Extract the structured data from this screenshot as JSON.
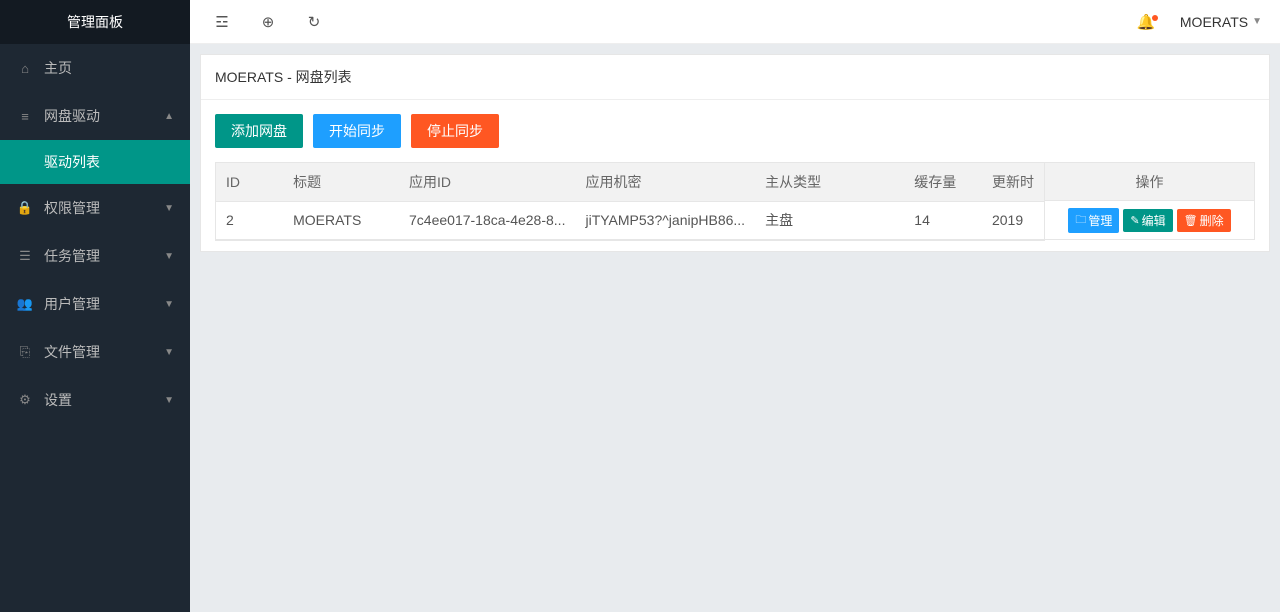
{
  "sidebar": {
    "title": "管理面板",
    "items": [
      {
        "icon": "⌂",
        "label": "主页",
        "expandable": false
      },
      {
        "icon": "≡",
        "label": "网盘驱动",
        "expandable": true,
        "expanded": true,
        "sub": [
          {
            "label": "驱动列表",
            "active": true
          }
        ]
      },
      {
        "icon": "🔒",
        "label": "权限管理",
        "expandable": true
      },
      {
        "icon": "☰",
        "label": "任务管理",
        "expandable": true
      },
      {
        "icon": "👥",
        "label": "用户管理",
        "expandable": true
      },
      {
        "icon": "⎘",
        "label": "文件管理",
        "expandable": true
      },
      {
        "icon": "⚙",
        "label": "设置",
        "expandable": true
      }
    ]
  },
  "topbar": {
    "user": "MOERATS"
  },
  "card": {
    "title": "MOERATS - 网盘列表",
    "buttons": {
      "add": "添加网盘",
      "startSync": "开始同步",
      "stopSync": "停止同步"
    }
  },
  "table": {
    "headers": {
      "id": "ID",
      "title": "标题",
      "appId": "应用ID",
      "appSecret": "应用机密",
      "masterType": "主从类型",
      "cache": "缓存量",
      "updated": "更新时",
      "ops": "操作"
    },
    "rows": [
      {
        "id": "2",
        "title": "MOERATS",
        "appId": "7c4ee017-18ca-4e28-8...",
        "appSecret": "jiTYAMP53?^janipHB86...",
        "masterType": "主盘",
        "cache": "14",
        "updated": "2019"
      }
    ],
    "ops": {
      "manage": "管理",
      "edit": "编辑",
      "delete": "删除"
    }
  }
}
